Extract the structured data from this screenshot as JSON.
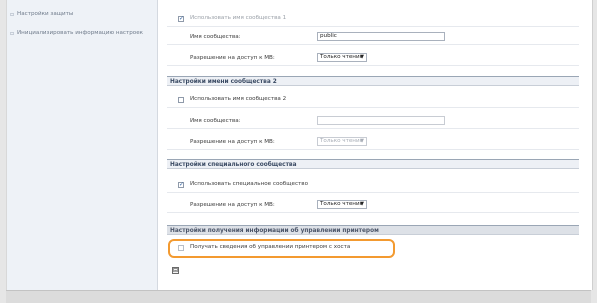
{
  "sidebar": {
    "items": [
      {
        "label": "Настройки защиты"
      },
      {
        "label": "Инициализировать информацию настроек"
      }
    ]
  },
  "community1": {
    "use_label": "Использовать имя сообщества 1",
    "name_label": "Имя сообщества:",
    "name_value": "public",
    "access_label": "Разрешение на доступ к МВ:",
    "access_value": "Только чтение"
  },
  "community2": {
    "header": "Настройки имени сообщества 2",
    "use_label": "Использовать имя сообщества 2",
    "name_label": "Имя сообщества:",
    "name_value": "",
    "access_label": "Разрешение на доступ к МВ:",
    "access_value": "Только чтение"
  },
  "special": {
    "header": "Настройки специального сообщества",
    "use_label": "Использовать специальное сообщество",
    "access_label": "Разрешение на доступ к МВ:",
    "access_value": "Только чтение"
  },
  "printer_mgmt": {
    "header": "Настройки получения информации об управлении принтером",
    "get_label": "Получать сведения об управлении принтером с хоста"
  },
  "icons": {
    "caret": "▼",
    "collapse": "⊟"
  },
  "colors": {
    "highlight": "#f39a30",
    "section_bg": "#edf0f5"
  }
}
